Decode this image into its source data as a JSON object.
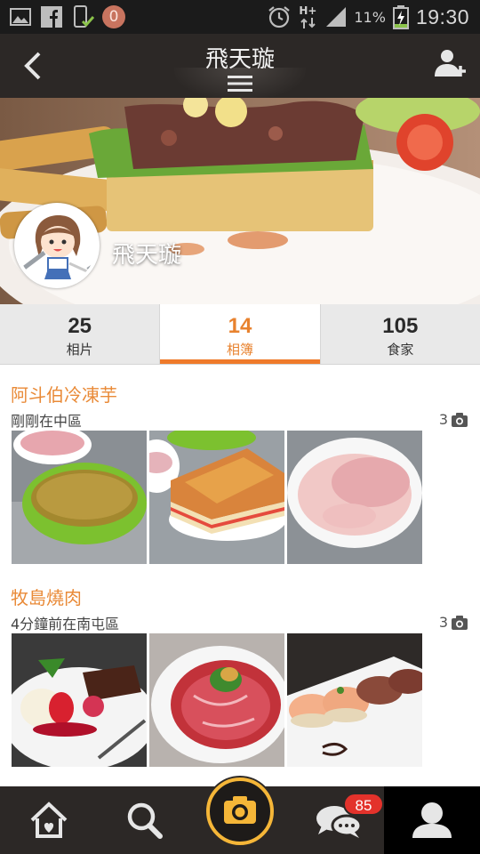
{
  "status_bar": {
    "notification_badge": "0",
    "network": "H+",
    "battery_percent": "11%",
    "time": "19:30",
    "icons": [
      "gallery-icon",
      "facebook-icon",
      "phone-check-icon",
      "alarm-icon",
      "signal-icon",
      "battery-charging-icon"
    ]
  },
  "header": {
    "title": "飛天璇",
    "icons": [
      "back-arrow-icon",
      "menu-icon",
      "add-user-icon"
    ]
  },
  "profile": {
    "name": "飛天璇"
  },
  "tabs": [
    {
      "count": "25",
      "label": "相片",
      "active": false
    },
    {
      "count": "14",
      "label": "相簿",
      "active": true
    },
    {
      "count": "105",
      "label": "食家",
      "active": false
    }
  ],
  "albums": [
    {
      "title": "阿斗伯冷凍芋",
      "subtitle": "剛剛在中區",
      "photo_count": "3",
      "photos": [
        "pink-dessert-green-bowl",
        "toast-sandwich",
        "taro-ice-bowl"
      ]
    },
    {
      "title": "牧島燒肉",
      "subtitle": "4分鐘前在南屯區",
      "photo_count": "3",
      "photos": [
        "brownie-ice-cream",
        "raw-beef-plate",
        "seared-sushi"
      ]
    }
  ],
  "bottom_nav": {
    "chat_badge": "85",
    "items": [
      "home-icon",
      "search-icon",
      "camera-icon",
      "chat-icon",
      "profile-icon"
    ]
  },
  "colors": {
    "accent": "#ef7a2a",
    "bar": "#2c2826",
    "badge": "#e3322b"
  }
}
